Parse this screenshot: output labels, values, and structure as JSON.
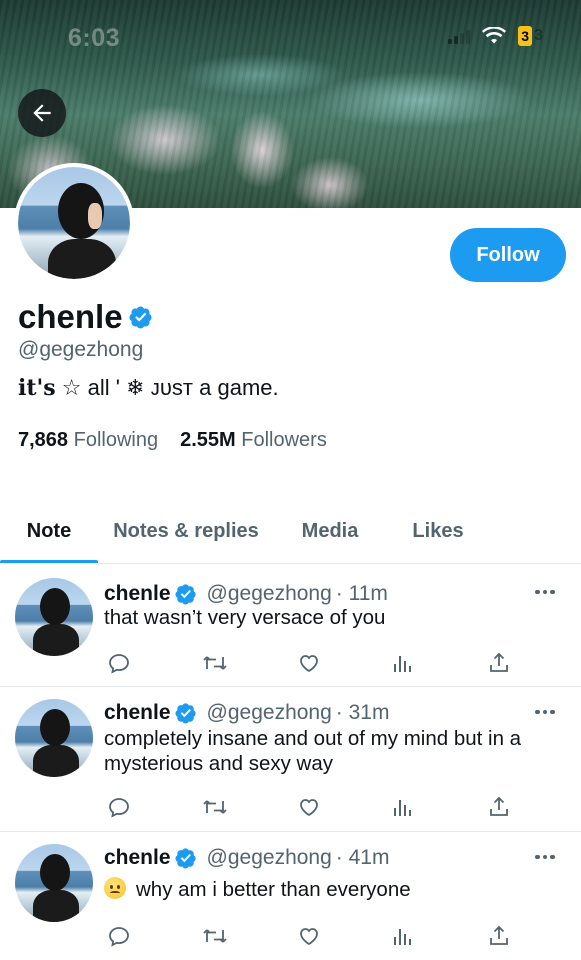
{
  "status_bar": {
    "time": "6:03",
    "battery_level": "3",
    "battery_rest": "3"
  },
  "profile": {
    "display_name": "chenle",
    "handle": "@gegezhong",
    "bio_prefix": "it's",
    "bio_star": "☆",
    "bio_mid": " all ' ",
    "bio_snow": "❄",
    "bio_just": " ᴊᴜsᴛ",
    "bio_suffix": " a game.",
    "following_count": "7,868",
    "following_label": "Following",
    "followers_count": "2.55M",
    "followers_label": "Followers",
    "follow_label": "Follow"
  },
  "tabs": [
    {
      "label": "Note",
      "active": true
    },
    {
      "label": "Notes & replies",
      "active": false
    },
    {
      "label": "Media",
      "active": false
    },
    {
      "label": "Likes",
      "active": false
    }
  ],
  "tweets": [
    {
      "name": "chenle",
      "handle": "@gegezhong",
      "time": "· 11m",
      "text": "that wasn’t very versace of you"
    },
    {
      "name": "chenle",
      "handle": "@gegezhong",
      "time": "· 31m",
      "text": "completely insane and out of my mind but in a mysterious and sexy way"
    },
    {
      "name": "chenle",
      "handle": "@gegezhong",
      "time": "· 41m",
      "text": "why am i better than everyone",
      "emoji": "sad-face"
    }
  ],
  "colors": {
    "accent": "#1d9bf0",
    "text": "#0f1419",
    "muted": "#536471",
    "divider": "#e6e9eb"
  },
  "icons": [
    "back-arrow-icon",
    "verified-icon",
    "reply-icon",
    "retweet-icon",
    "like-icon",
    "views-icon",
    "share-icon",
    "more-icon"
  ]
}
